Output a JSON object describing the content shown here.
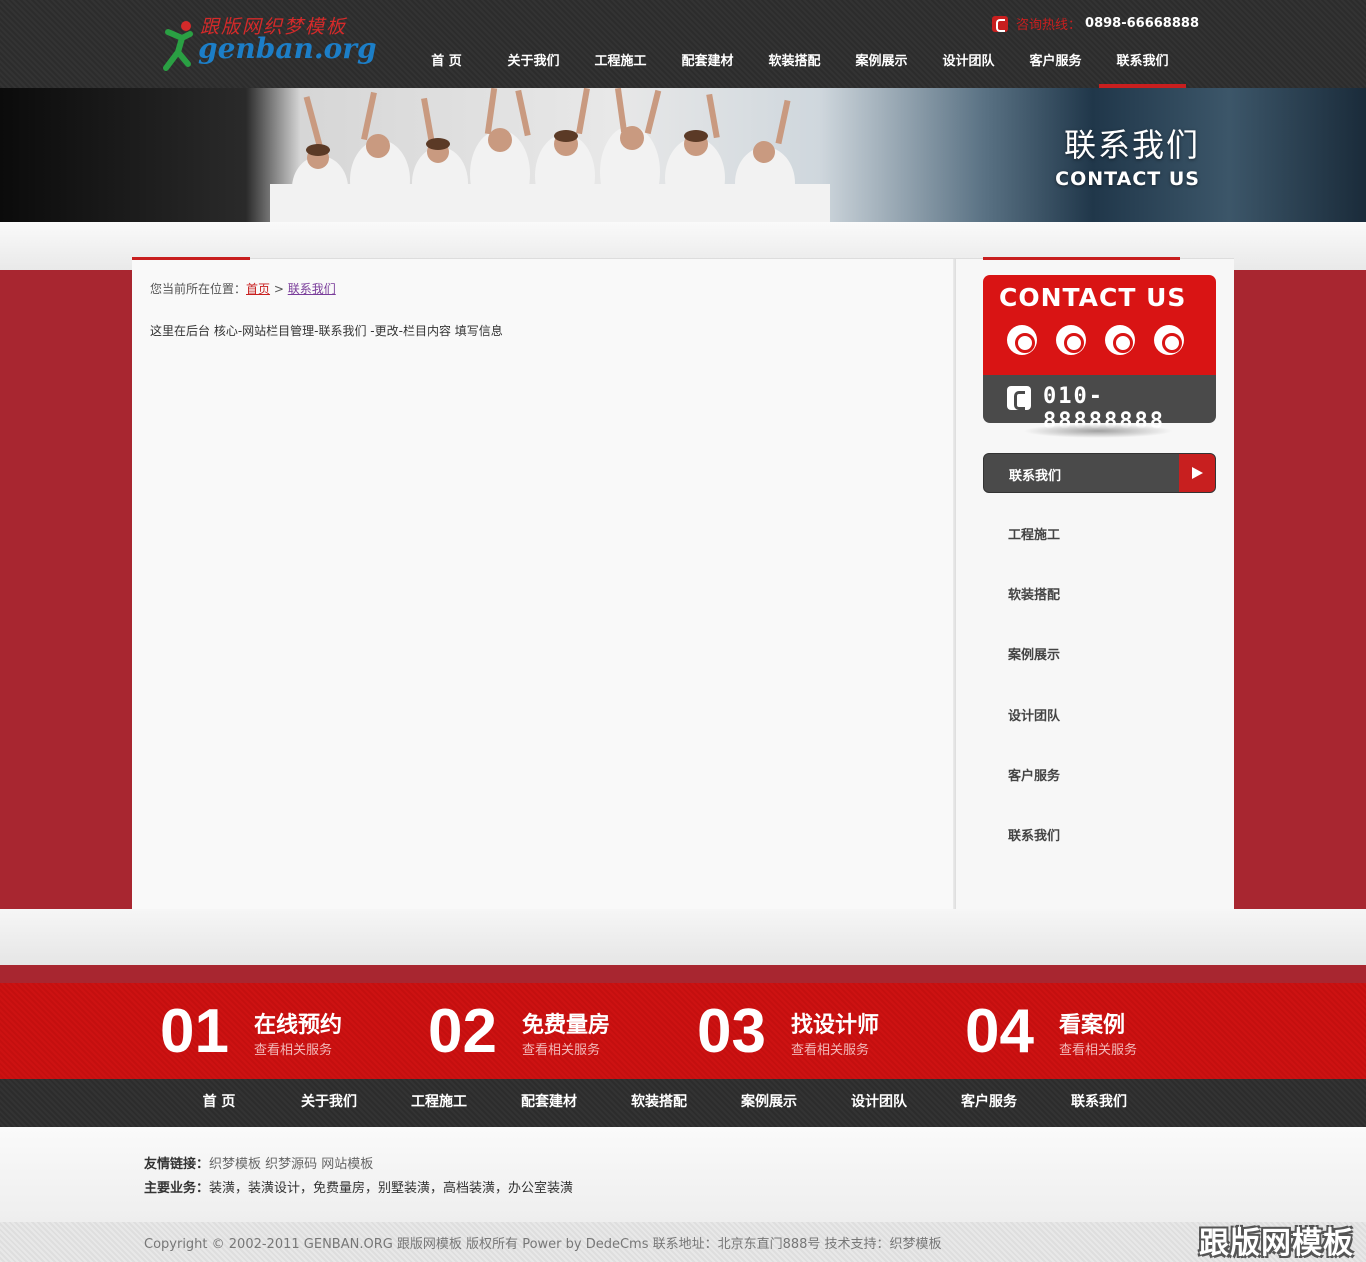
{
  "header": {
    "logo_cn": "跟版网织梦模板",
    "logo_en": "genban.org",
    "hotline_label": "咨询热线：",
    "hotline_number": "0898-66668888",
    "nav": [
      "首 页",
      "关于我们",
      "工程施工",
      "配套建材",
      "软装搭配",
      "案例展示",
      "设计团队",
      "客户服务",
      "联系我们"
    ],
    "active_index": 8
  },
  "banner": {
    "title": "联系我们",
    "subtitle": "CONTACT US"
  },
  "main": {
    "breadcrumb_prefix": "您当前所在位置：",
    "breadcrumb_home": "首页",
    "breadcrumb_sep": " > ",
    "breadcrumb_current": "联系我们",
    "body_text": "这里在后台  核心-网站栏目管理-联系我们 -更改-栏目内容 填写信息"
  },
  "sidebar": {
    "contact_title": "CONTACT US",
    "social_icons": [
      "weibo-icon",
      "pinterest-icon",
      "renren-icon",
      "star-icon"
    ],
    "phone": "010-88888888",
    "section_title": "联系我们",
    "items": [
      "工程施工",
      "软装搭配",
      "案例展示",
      "设计团队",
      "客户服务",
      "联系我们"
    ]
  },
  "steps": [
    {
      "num": "01",
      "title": "在线预约",
      "sub": "查看相关服务"
    },
    {
      "num": "02",
      "title": "免费量房",
      "sub": "查看相关服务"
    },
    {
      "num": "03",
      "title": "找设计师",
      "sub": "查看相关服务"
    },
    {
      "num": "04",
      "title": "看案例",
      "sub": "查看相关服务"
    }
  ],
  "footer_nav": [
    "首 页",
    "关于我们",
    "工程施工",
    "配套建材",
    "软装搭配",
    "案例展示",
    "设计团队",
    "客户服务",
    "联系我们"
  ],
  "footer": {
    "links_label": "友情链接：",
    "links": "织梦模板 织梦源码 网站模板",
    "business_label": "主要业务：",
    "business": "装潢，装潢设计，免费量房，别墅装潢，高档装潢，办公室装潢",
    "copyright": "Copyright © 2002-2011 GENBAN.ORG 跟版网模板 版权所有 Power by DedeCms 联系地址：北京东直门888号 技术支持：织梦模板",
    "watermark": "跟版网模板"
  },
  "colors": {
    "accent": "#c81f1f",
    "band": "#a82630",
    "dark": "#333333"
  }
}
